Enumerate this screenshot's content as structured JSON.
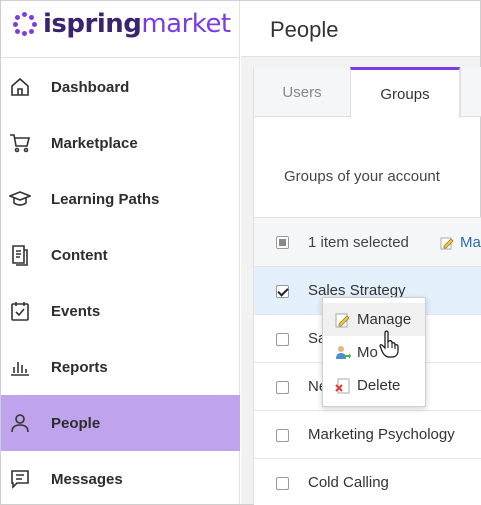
{
  "brand": {
    "logo_bold": "ispring",
    "logo_light": "market",
    "accent": "#7a3ee0"
  },
  "sidebar": {
    "items": [
      {
        "label": "Dashboard",
        "icon": "home-icon"
      },
      {
        "label": "Marketplace",
        "icon": "cart-icon"
      },
      {
        "label": "Learning Paths",
        "icon": "graduation-cap-icon"
      },
      {
        "label": "Content",
        "icon": "document-icon"
      },
      {
        "label": "Events",
        "icon": "calendar-check-icon"
      },
      {
        "label": "Reports",
        "icon": "bar-chart-icon"
      },
      {
        "label": "People",
        "icon": "person-icon",
        "active": true
      },
      {
        "label": "Messages",
        "icon": "message-icon"
      }
    ],
    "active_color": "#bfa3ec"
  },
  "header": {
    "title": "People"
  },
  "tabs": [
    {
      "label": "Users"
    },
    {
      "label": "Groups",
      "active": true
    }
  ],
  "groups": {
    "subtitle": "Groups of your account",
    "selection_text": "1 item selected",
    "manage_action": "Ma",
    "rows": [
      {
        "label": "Sales Strategy",
        "checked": true
      },
      {
        "label": "Sa",
        "checked": false
      },
      {
        "label": "Ne",
        "checked": false
      },
      {
        "label": "Marketing Psychology",
        "checked": false
      },
      {
        "label": "Cold Calling",
        "checked": false
      }
    ]
  },
  "context_menu": {
    "items": [
      {
        "label": "Manage",
        "icon": "pencil-icon"
      },
      {
        "label": "Mo",
        "icon": "move-user-icon"
      },
      {
        "label": "Delete",
        "icon": "delete-icon"
      }
    ]
  }
}
